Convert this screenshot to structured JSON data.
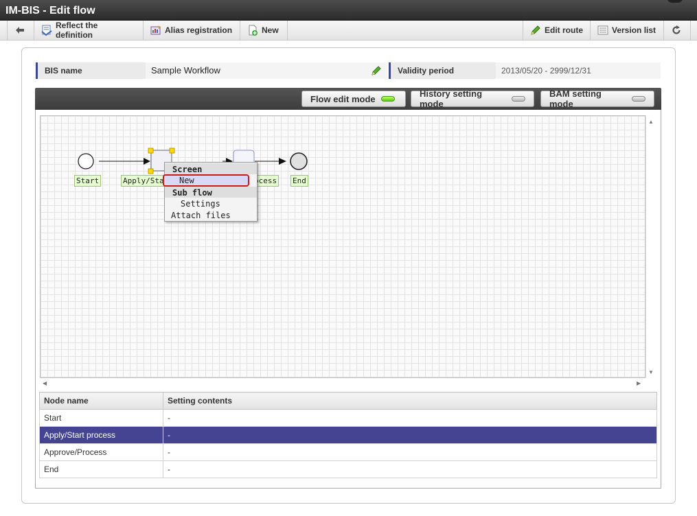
{
  "window": {
    "title": "IM-BIS - Edit flow"
  },
  "toolbar": {
    "back_icon": "back-arrow-icon",
    "reflect_label": "Reflect the definition",
    "alias_label": "Alias registration",
    "new_label": "New",
    "edit_route_label": "Edit route",
    "version_list_label": "Version list",
    "refresh_icon": "refresh-icon"
  },
  "info": {
    "bis_name_label": "BIS name",
    "bis_name_value": "Sample Workflow",
    "validity_label": "Validity period",
    "validity_value": "2013/05/20  -  2999/12/31"
  },
  "modes": {
    "flow_edit": {
      "label": "Flow edit mode",
      "active": true
    },
    "history_setting": {
      "label": "History setting mode",
      "active": false
    },
    "bam_setting": {
      "label": "BAM setting mode",
      "active": false
    }
  },
  "flow": {
    "nodes": {
      "start": "Start",
      "apply_start": "Apply/Start process",
      "approve_process": "Approve/Process",
      "end": "End"
    },
    "labels_visible": {
      "start": "Start",
      "apply_start": "Apply/Star",
      "approve_process": "ocess",
      "end": "End"
    }
  },
  "context_menu": {
    "screen_header": "Screen",
    "new_item": "New",
    "subflow_header": "Sub flow",
    "settings_item": "Settings",
    "attach_item": "Attach files"
  },
  "table": {
    "headers": {
      "node_name": "Node name",
      "setting_contents": "Setting contents"
    },
    "rows": [
      {
        "node": "Start",
        "setting": "-",
        "selected": false
      },
      {
        "node": "Apply/Start process",
        "setting": "-",
        "selected": true
      },
      {
        "node": "Approve/Process",
        "setting": "-",
        "selected": false
      },
      {
        "node": "End",
        "setting": "-",
        "selected": false
      }
    ]
  },
  "colors": {
    "accent_dark": "#3d3d3d",
    "selected_row": "#444493",
    "active_led": "#5fcc17",
    "highlight_border": "#cc1a1a",
    "node_label_bg": "#e6ffd0"
  }
}
